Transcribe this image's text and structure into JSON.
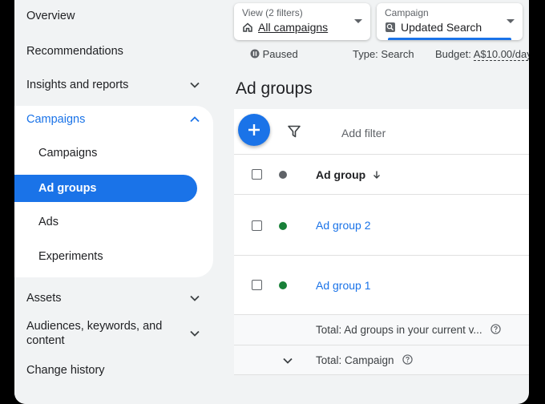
{
  "colors": {
    "accent": "#1a73e8",
    "enabled_dot": "#188038",
    "header_dot": "#5f6368"
  },
  "sidebar": {
    "overview": "Overview",
    "recommendations": "Recommendations",
    "insights": "Insights and reports",
    "campaigns_section": "Campaigns",
    "sub": {
      "campaigns": "Campaigns",
      "ad_groups": "Ad groups",
      "ads": "Ads",
      "experiments": "Experiments"
    },
    "assets": "Assets",
    "audiences_line1": "Audiences, keywords, and",
    "audiences_line2": "content",
    "change_history": "Change history"
  },
  "view_filter": {
    "label": "View (2 filters)",
    "value": "All campaigns"
  },
  "campaign_select": {
    "label": "Campaign",
    "value": "Updated Search"
  },
  "status": {
    "state": "Paused",
    "type": "Type: Search",
    "budget_label": "Budget:",
    "budget_value": "A$10.00/day"
  },
  "page_title": "Ad groups",
  "toolbar": {
    "add_filter": "Add filter"
  },
  "table": {
    "header": "Ad group",
    "rows": [
      {
        "name": "Ad group 2"
      },
      {
        "name": "Ad group 1"
      }
    ],
    "total_current": "Total: Ad groups in your current v...",
    "total_campaign": "Total: Campaign"
  }
}
